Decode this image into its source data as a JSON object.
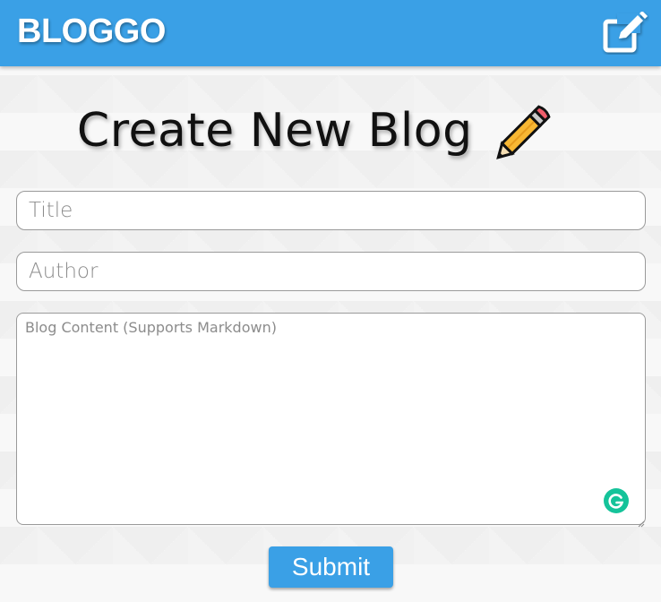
{
  "header": {
    "brand": "BLOGGO",
    "edit_icon": "edit-note-icon",
    "color": "#3aa0e6"
  },
  "page": {
    "title": "Create New Blog",
    "title_icon": "pencil-icon"
  },
  "form": {
    "title_placeholder": "Title",
    "title_value": "",
    "author_placeholder": "Author",
    "author_value": "",
    "content_placeholder": "Blog Content (Supports Markdown)",
    "content_value": "",
    "grammarly_icon": "grammarly-icon",
    "submit_label": "Submit"
  }
}
